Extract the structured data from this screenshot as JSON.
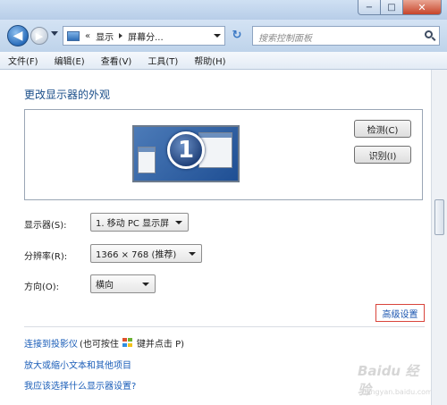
{
  "window": {
    "minimize_glyph": "−",
    "maximize_glyph": "□",
    "close_glyph": "✕"
  },
  "nav": {
    "back_glyph": "◀",
    "forward_glyph": "▶",
    "refresh_glyph": "↻"
  },
  "address": {
    "separator": "«",
    "crumbs": [
      "显示",
      "屏幕分..."
    ]
  },
  "search": {
    "placeholder": "搜索控制面板"
  },
  "menu": [
    "文件(F)",
    "编辑(E)",
    "查看(V)",
    "工具(T)",
    "帮助(H)"
  ],
  "page": {
    "title": "更改显示器的外观",
    "monitor_number": "1",
    "detect_button": "检测(C)",
    "identify_button": "识别(I)"
  },
  "fields": {
    "display_label": "显示器(S):",
    "display_value": "1. 移动 PC 显示屏",
    "resolution_label": "分辨率(R):",
    "resolution_value": "1366 × 768 (推荐)",
    "orientation_label": "方向(O):",
    "orientation_value": "横向"
  },
  "advanced_label": "高级设置",
  "links": {
    "projector_link": "连接到投影仪",
    "projector_hint_a": "(也可按住",
    "projector_hint_b": "键并点击 P)",
    "text_size_link": "放大或缩小文本和其他项目",
    "which_settings_link": "我应该选择什么显示器设置?"
  },
  "watermark": {
    "text": "Baidu 经验",
    "sub": "jingyan.baidu.com"
  },
  "colors": {
    "accent_link": "#1a5db8",
    "advanced_border": "#d9443b",
    "title_blue": "#1b4f8a"
  }
}
